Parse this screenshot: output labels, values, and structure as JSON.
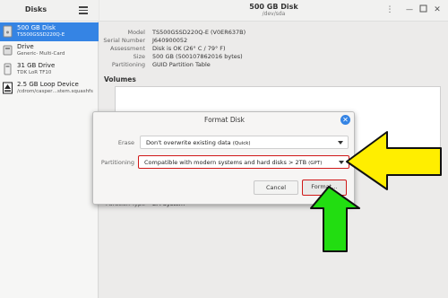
{
  "sidebar": {
    "title": "Disks",
    "drives": [
      {
        "name": "500 GB Disk",
        "sub": "TS500GSSD220Q-E"
      },
      {
        "name": "Drive",
        "sub": "Generic- Multi-Card"
      },
      {
        "name": "31 GB Drive",
        "sub": "TDK LoR TF10"
      },
      {
        "name": "2.5 GB Loop Device",
        "sub": "/cdrom/casper…stem.squashfs"
      }
    ]
  },
  "header": {
    "title": "500 GB Disk",
    "subtitle": "/dev/sda"
  },
  "details": [
    {
      "label": "Model",
      "value": "TS500GSSD220Q-E (V0ER637B)"
    },
    {
      "label": "Serial Number",
      "value": "J640900052"
    },
    {
      "label": "Assessment",
      "value": "Disk is OK (26° C / 79° F)"
    },
    {
      "label": "Size",
      "value": "500 GB (500107862016 bytes)"
    },
    {
      "label": "Partitioning",
      "value": "GUID Partition Table"
    }
  ],
  "volumes": {
    "title": "Volumes",
    "partial_label": "Partition Type",
    "partial_value": "EFI System",
    "minus": "−"
  },
  "dialog": {
    "title": "Format Disk",
    "erase_label": "Erase",
    "erase_value": "Don't overwrite existing data",
    "erase_hint": "(Quick)",
    "partitioning_label": "Partitioning",
    "partitioning_value": "Compatible with modern systems and hard disks > 2TB",
    "partitioning_hint": "(GPT)",
    "cancel": "Cancel",
    "format": "Format…"
  },
  "colors": {
    "accent": "#3584e4",
    "highlight": "#d01818",
    "arrow_yellow": "#ffee00",
    "arrow_green": "#22dd11"
  }
}
